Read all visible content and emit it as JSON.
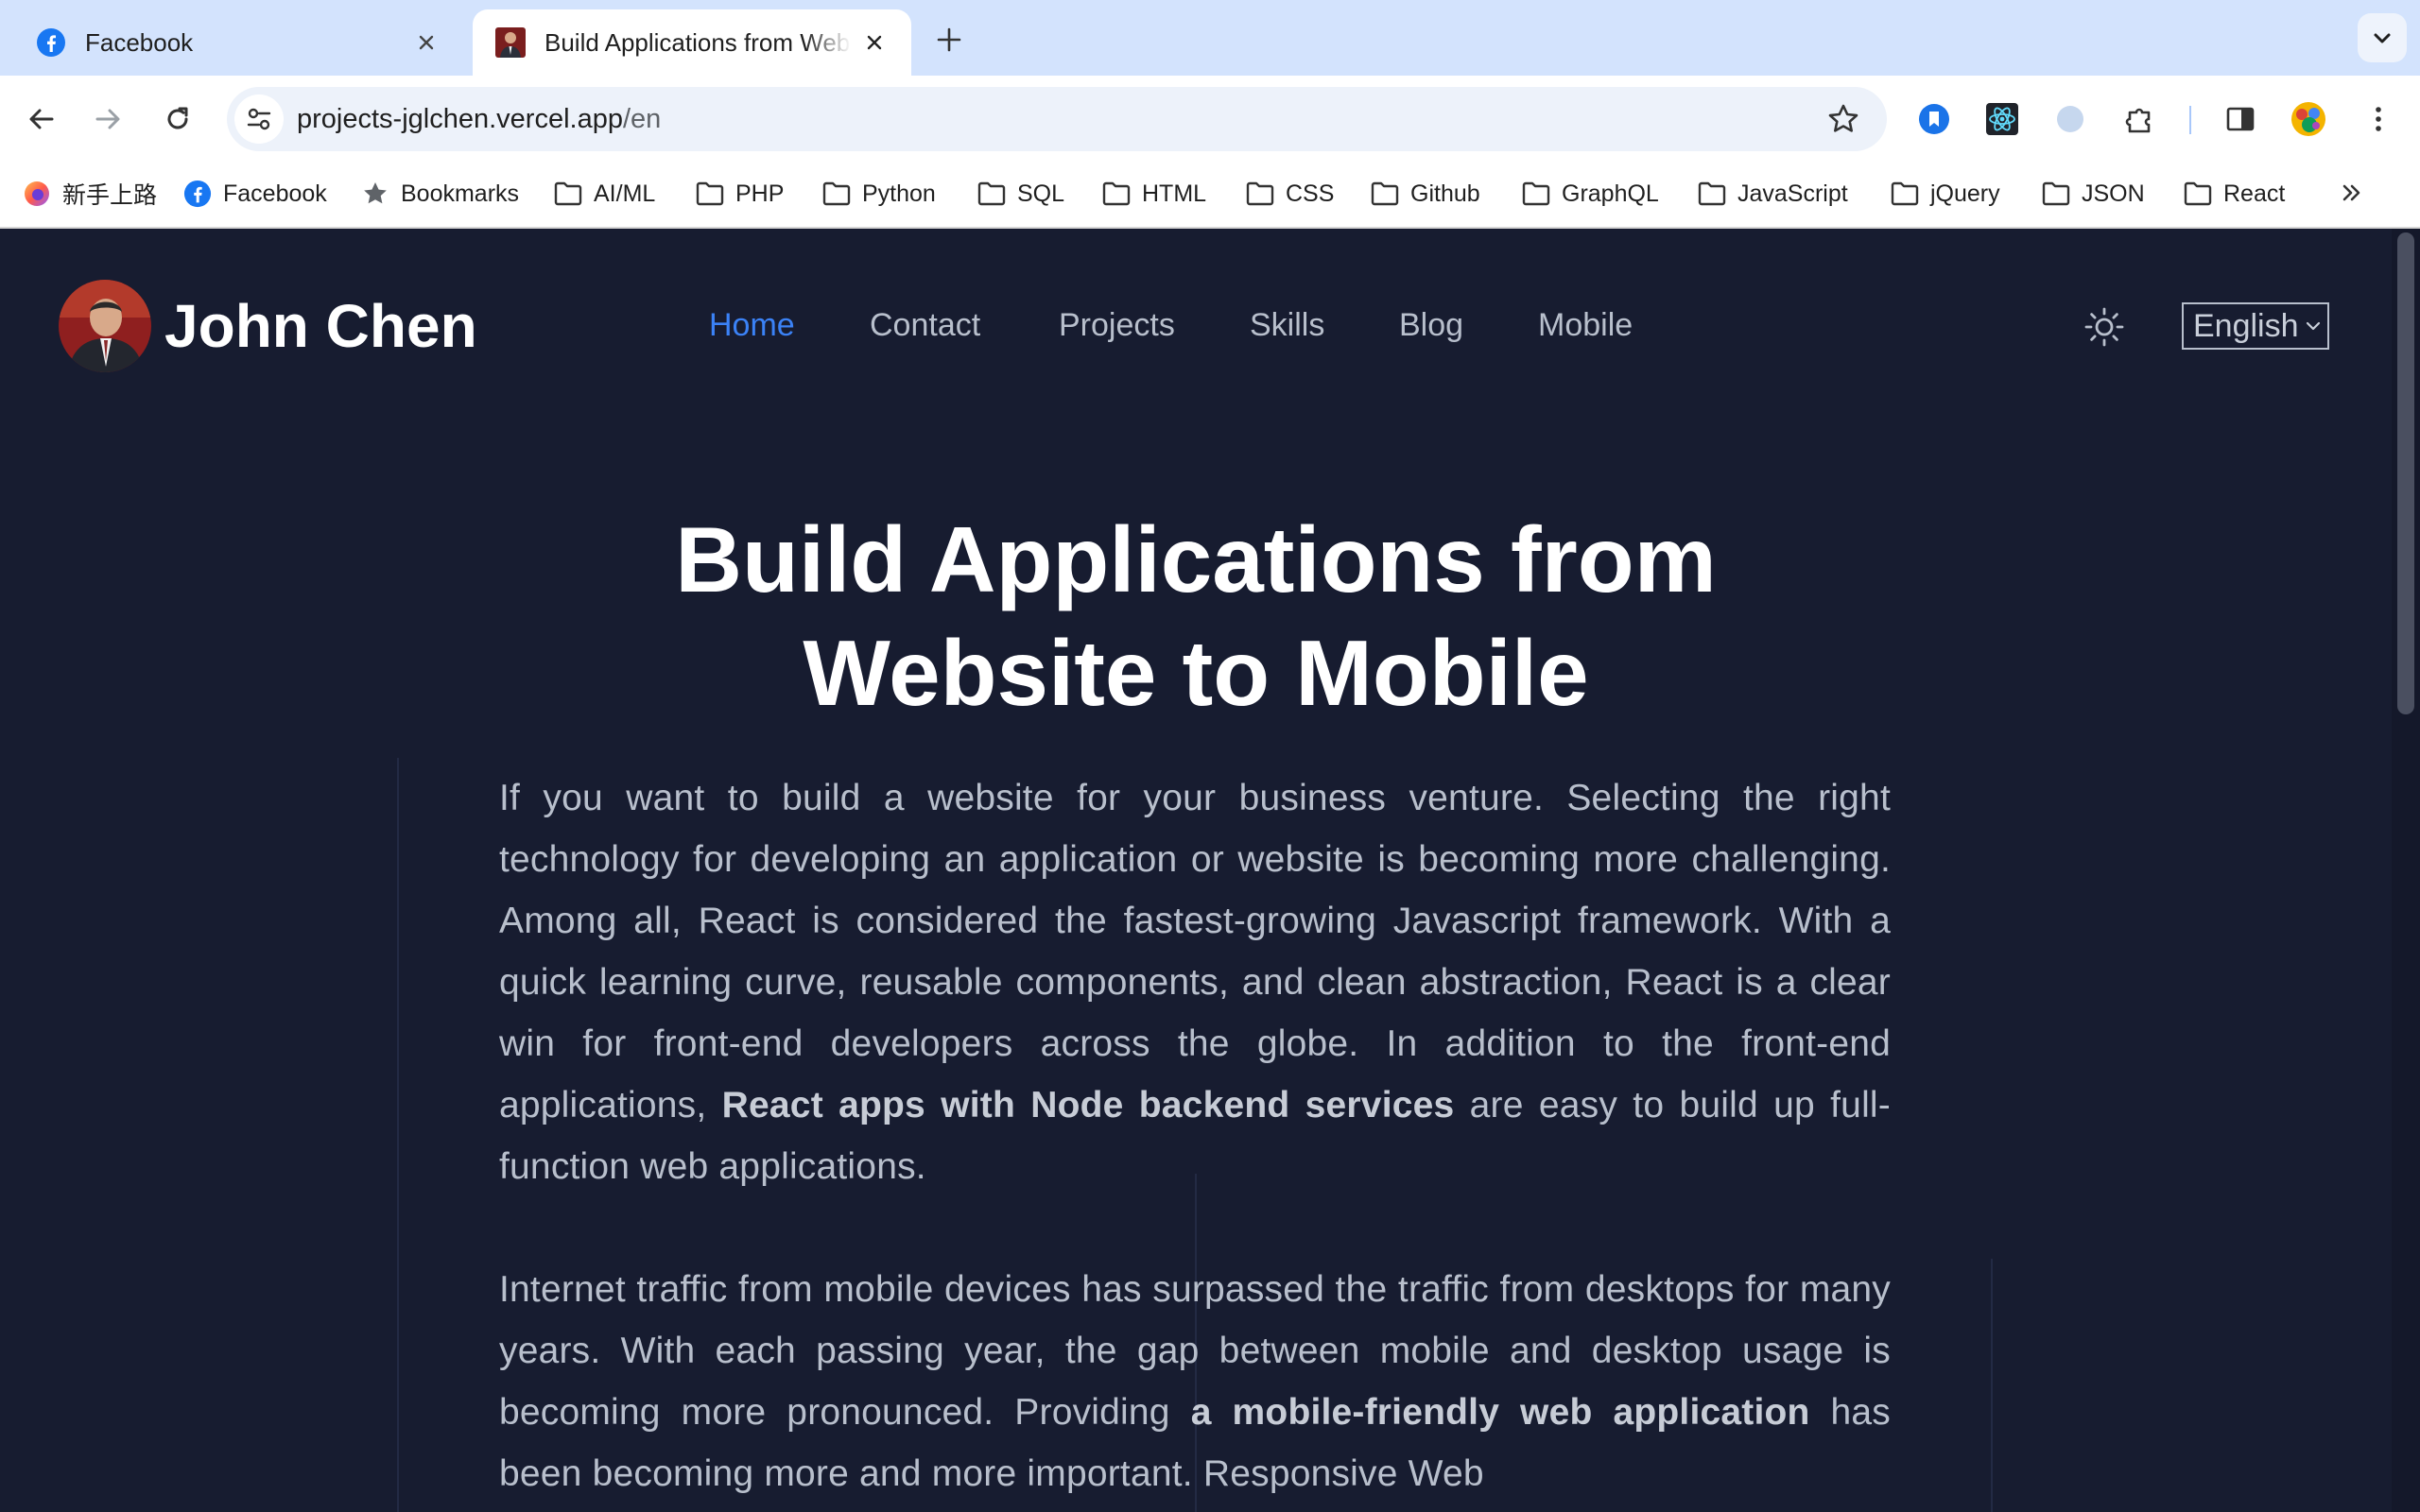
{
  "tabs": [
    {
      "title": "Facebook",
      "favicon": "facebook-icon",
      "active": false
    },
    {
      "title": "Build Applications from Website to Mobile",
      "favicon": "john-chen-avatar",
      "active": true
    }
  ],
  "toolbar": {
    "url_host": "projects-jglchen.vercel.app",
    "url_path": "/en"
  },
  "bookmarks": [
    {
      "label": "新手上路",
      "icon": "firefox-icon"
    },
    {
      "label": "Facebook",
      "icon": "facebook-icon"
    },
    {
      "label": "Bookmarks",
      "icon": "star-icon"
    },
    {
      "label": "AI/ML",
      "icon": "folder-icon"
    },
    {
      "label": "PHP",
      "icon": "folder-icon"
    },
    {
      "label": "Python",
      "icon": "folder-icon"
    },
    {
      "label": "SQL",
      "icon": "folder-icon"
    },
    {
      "label": "HTML",
      "icon": "folder-icon"
    },
    {
      "label": "CSS",
      "icon": "folder-icon"
    },
    {
      "label": "Github",
      "icon": "folder-icon"
    },
    {
      "label": "GraphQL",
      "icon": "folder-icon"
    },
    {
      "label": "JavaScript",
      "icon": "folder-icon"
    },
    {
      "label": "jQuery",
      "icon": "folder-icon"
    },
    {
      "label": "JSON",
      "icon": "folder-icon"
    },
    {
      "label": "React",
      "icon": "folder-icon"
    }
  ],
  "site": {
    "brand": "John Chen",
    "nav": [
      "Home",
      "Contact",
      "Projects",
      "Skills",
      "Blog",
      "Mobile"
    ],
    "active_nav": "Home",
    "language": "English",
    "hero_line1": "Build Applications from",
    "hero_line2": "Website to Mobile",
    "p1_text": "If you want to build a website for your business venture. Selecting the right technology for developing an application or website is becoming more challenging. Among all, React is considered the fastest-growing Javascript framework. With a quick learning curve, reusable components, and clean abstraction, React is a clear win for front-end developers across the globe. In addition to the front-end applications,",
    "p1_bold": "React apps with Node backend services",
    "p1_end": "are easy to build up full-function web applications.",
    "p2_text": "Internet traffic from mobile devices has surpassed the traffic from desktops for many years. With each passing year, the gap between mobile and desktop usage is becoming more pronounced. Providing",
    "p2_bold": "a mobile-friendly web application",
    "p2_end": "has been becoming more and more important. Responsive Web"
  },
  "colors": {
    "page_bg": "#171c30",
    "nav_active": "#3b82f6",
    "nav_text": "#b8bfcc",
    "tabstrip_bg": "#d3e3fd"
  }
}
